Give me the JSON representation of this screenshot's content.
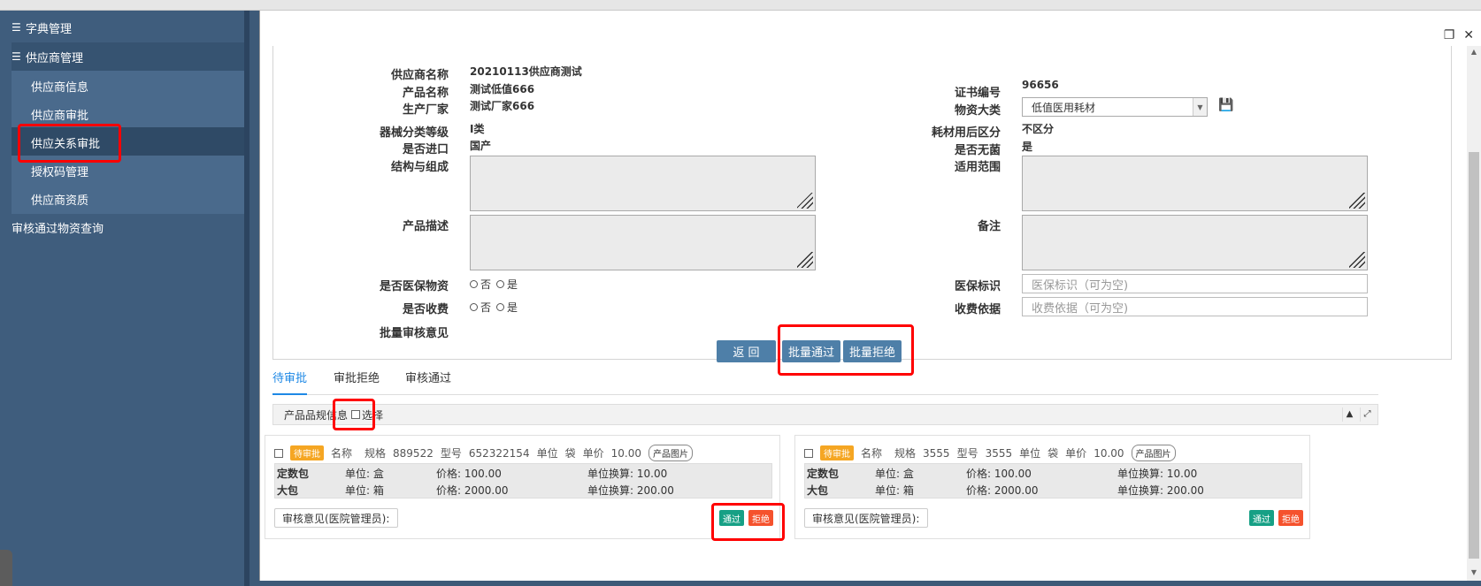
{
  "sidebar": {
    "menu_dict": "字典管理",
    "menu_supplier": "供应商管理",
    "items": [
      {
        "label": "供应商信息"
      },
      {
        "label": "供应商审批"
      },
      {
        "label": "供应关系审批"
      },
      {
        "label": "授权码管理"
      },
      {
        "label": "供应商资质"
      }
    ],
    "approved_query": "审核通过物资查询"
  },
  "form": {
    "supplier_name_label": "供应商名称",
    "supplier_name": "20210113供应商测试",
    "product_name_label": "产品名称",
    "product_name": "测试低值666",
    "manufacturer_label": "生产厂家",
    "manufacturer": "测试厂家666",
    "cert_no_label": "证书编号",
    "cert_no": "96656",
    "material_cat_label": "物资大类",
    "material_cat": "低值医用耗材",
    "device_class_label": "器械分类等级",
    "device_class": "I类",
    "after_use_label": "耗材用后区分",
    "after_use": "不区分",
    "imported_label": "是否进口",
    "imported": "国产",
    "sterile_label": "是否无菌",
    "sterile": "是",
    "structure_label": "结构与组成",
    "scope_label": "适用范围",
    "desc_label": "产品描述",
    "remark_label": "备注",
    "medicare_label": "是否医保物资",
    "medicare_no": "否",
    "medicare_yes": "是",
    "medicare_flag_label": "医保标识",
    "medicare_flag_placeholder": "医保标识（可为空)",
    "charge_label": "是否收费",
    "charge_no": "否",
    "charge_yes": "是",
    "charge_basis_label": "收费依据",
    "charge_basis_placeholder": "收费依据（可为空)",
    "batch_opinion_label": "批量审核意见"
  },
  "actions": {
    "back": "返 回",
    "batch_pass": "批量通过",
    "batch_reject": "批量拒绝"
  },
  "tabs": [
    {
      "label": "待审批"
    },
    {
      "label": "审批拒绝"
    },
    {
      "label": "审核通过"
    }
  ],
  "panel": {
    "title": "产品品规信息",
    "select": "选择"
  },
  "cards": [
    {
      "status": "待审批",
      "name_label": "名称",
      "spec_label": "规格",
      "spec": "889522",
      "model_label": "型号",
      "model": "652322154",
      "unit_label": "单位",
      "unit": "袋",
      "price_label": "单价",
      "price": "10.00",
      "pic_btn": "产品图片",
      "pkg": [
        {
          "name": "定数包",
          "unit": "单位:  盒",
          "price": "价格:  100.00",
          "conv": "单位换算:  10.00"
        },
        {
          "name": "大包",
          "unit": "单位:  箱",
          "price": "价格:  2000.00",
          "conv": "单位换算:  200.00"
        }
      ],
      "opinion": "审核意见(医院管理员):",
      "pass": "通过",
      "reject": "拒绝"
    },
    {
      "status": "待审批",
      "name_label": "名称",
      "spec_label": "规格",
      "spec": "3555",
      "model_label": "型号",
      "model": "3555",
      "unit_label": "单位",
      "unit": "袋",
      "price_label": "单价",
      "price": "10.00",
      "pic_btn": "产品图片",
      "pkg": [
        {
          "name": "定数包",
          "unit": "单位:  盒",
          "price": "价格:  100.00",
          "conv": "单位换算:  10.00"
        },
        {
          "name": "大包",
          "unit": "单位:  箱",
          "price": "价格:  2000.00",
          "conv": "单位换算:  200.00"
        }
      ],
      "opinion": "审核意见(医院管理员):",
      "pass": "通过",
      "reject": "拒绝"
    }
  ]
}
